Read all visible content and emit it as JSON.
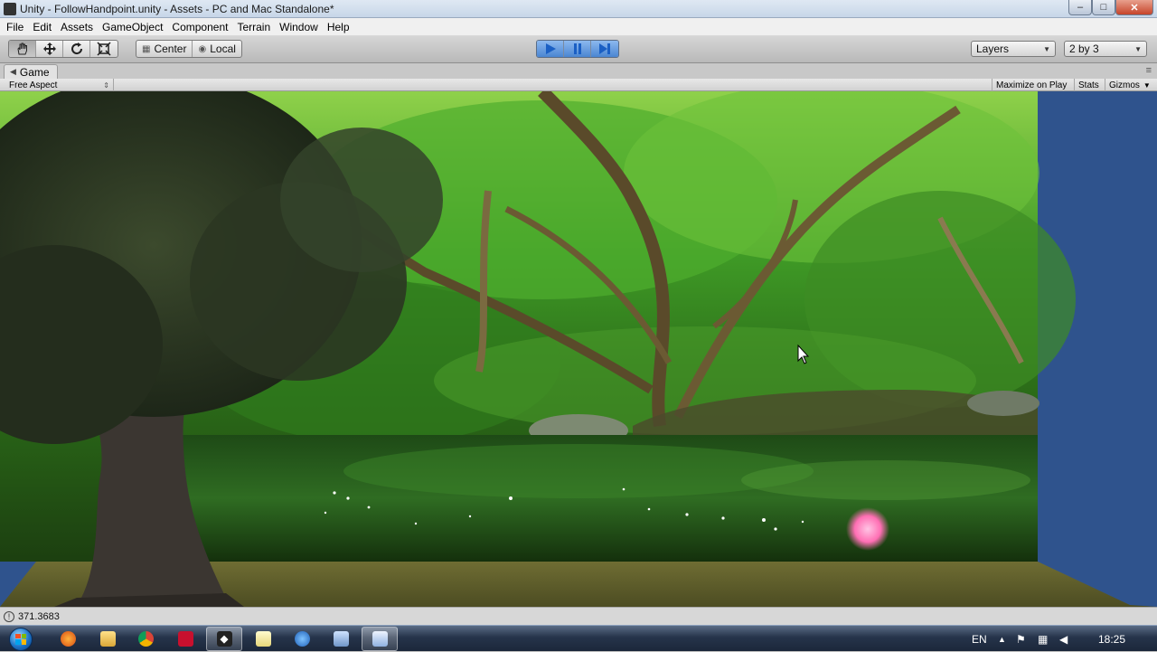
{
  "window": {
    "title": "Unity - FollowHandpoint.unity - Assets - PC and Mac Standalone*",
    "minimize": "–",
    "maximize": "□",
    "close": "✕"
  },
  "menu": [
    "File",
    "Edit",
    "Assets",
    "GameObject",
    "Component",
    "Terrain",
    "Window",
    "Help"
  ],
  "toolbar": {
    "tools": [
      "hand-tool-icon",
      "move-tool-icon",
      "rotate-tool-icon",
      "scale-tool-icon"
    ],
    "pivot_mode": "Center",
    "pivot_rotation": "Local",
    "play_controls": [
      "play-icon",
      "pause-icon",
      "step-icon"
    ],
    "layers_label": "Layers",
    "layout_label": "2 by 3"
  },
  "game_panel": {
    "tab_label": "Game",
    "aspect": "Free Aspect",
    "maximize_on_play": "Maximize on Play",
    "stats": "Stats",
    "gizmos": "Gizmos"
  },
  "status": {
    "message": "371.3683"
  },
  "taskbar": {
    "apps": [
      "firefox-icon",
      "explorer-icon",
      "chrome-icon",
      "acrobat-icon",
      "unity-icon",
      "notepad-icon",
      "windows-media-icon",
      "network-app-icon",
      "document-app-icon"
    ],
    "language": "EN",
    "time": "18:25"
  },
  "colors": {
    "viewport_background": "#2f538d",
    "play_button": "#4b86d2",
    "particle_pink": "#ff6fb4"
  }
}
